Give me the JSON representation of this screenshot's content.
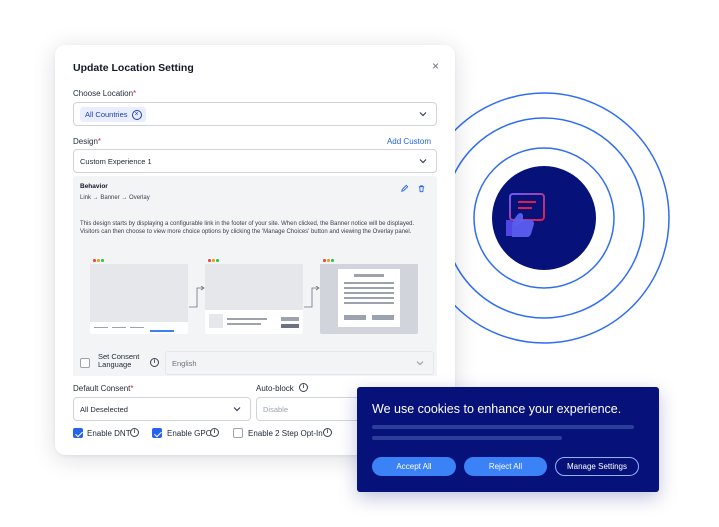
{
  "modal": {
    "title": "Update Location Setting",
    "close_label": "×",
    "location": {
      "label": "Choose Location",
      "required_mark": "*",
      "chip": "All Countries",
      "chip_remove": "×"
    },
    "design": {
      "label": "Design",
      "required_mark": "*",
      "add_custom": "Add Custom",
      "value": "Custom Experience 1"
    },
    "behavior": {
      "title": "Behavior",
      "flow": "Link → Banner → Overlay",
      "description": "This design starts by displaying a configurable link in the footer of your site. When clicked, the Banner notice will be displayed. Visitors can then choose to view more choice options by clicking the 'Manage Choices' button and viewing the Overlay panel."
    },
    "consent_language": {
      "label": "Set Consent Language",
      "value": "English",
      "info": "i"
    },
    "default_consent": {
      "label": "Default Consent",
      "required_mark": "*",
      "value": "All Deselected"
    },
    "auto_block": {
      "label": "Auto-block",
      "value": "Disable",
      "info": "i"
    },
    "options": [
      {
        "label": "Enable DNT",
        "checked": true,
        "info": "i"
      },
      {
        "label": "Enable GPC",
        "checked": true,
        "info": "i"
      },
      {
        "label": "Enable 2 Step Opt-In",
        "checked": false,
        "info": "i"
      }
    ]
  },
  "hero_icon": "consent-thumbs-up-chat-icon",
  "banner": {
    "title": "We use cookies to enhance your experience.",
    "buttons": {
      "accept": "Accept All",
      "reject": "Reject All",
      "manage": "Manage Settings"
    }
  },
  "colors": {
    "primary": "#2563eb",
    "navy": "#06127a",
    "ring": "#1d4ed8",
    "required": "#e11d48"
  }
}
